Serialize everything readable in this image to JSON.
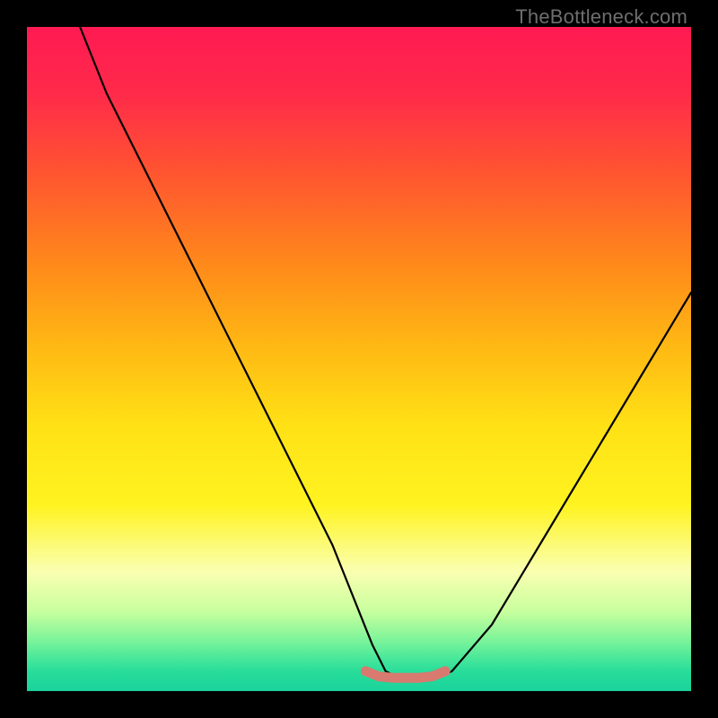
{
  "watermark": "TheBottleneck.com",
  "chart_data": {
    "type": "line",
    "title": "",
    "xlabel": "",
    "ylabel": "",
    "xlim": [
      0,
      100
    ],
    "ylim": [
      0,
      100
    ],
    "grid": false,
    "series": [
      {
        "name": "curve",
        "x": [
          8,
          12,
          18,
          25,
          33,
          40,
          46,
          50,
          52,
          54,
          56,
          58,
          60,
          62,
          64,
          70,
          76,
          82,
          88,
          94,
          100
        ],
        "values": [
          100,
          90,
          78,
          64,
          48,
          34,
          22,
          12,
          7,
          3,
          2,
          2,
          2,
          2,
          3,
          10,
          20,
          30,
          40,
          50,
          60
        ]
      },
      {
        "name": "marker-band",
        "x": [
          51,
          53,
          55,
          57,
          59,
          61,
          63
        ],
        "values": [
          3,
          2.2,
          2,
          2,
          2,
          2.2,
          3
        ]
      }
    ],
    "colors": {
      "curve": "#000000",
      "marker": "#d87a6f",
      "gradient_top": "#ff1a52",
      "gradient_bottom": "#1ad39c"
    },
    "annotations": []
  }
}
